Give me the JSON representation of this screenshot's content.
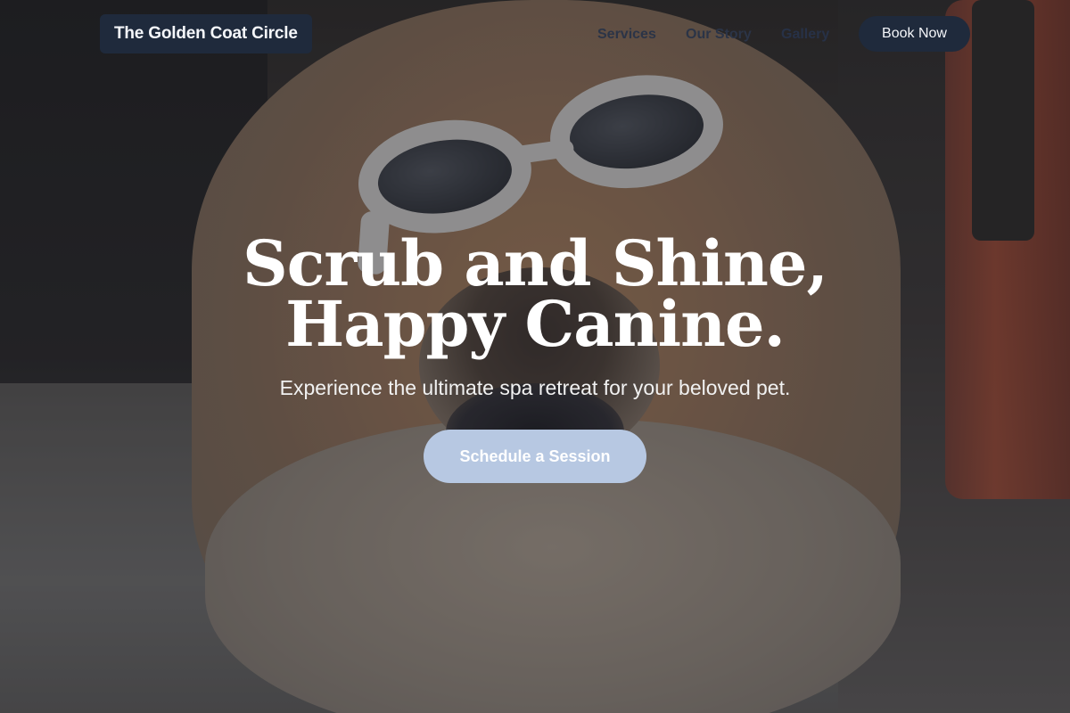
{
  "brand": {
    "name": "The Golden Coat Circle"
  },
  "nav": {
    "links": [
      "Services",
      "Our Story",
      "Gallery"
    ],
    "book_label": "Book Now"
  },
  "hero": {
    "headline_line1": "Scrub and Shine,",
    "headline_line2": "Happy Canine.",
    "subtitle": "Experience the ultimate spa retreat for your beloved pet.",
    "cta_label": "Schedule a Session",
    "background_image": "dog-with-sunglasses-photo"
  },
  "colors": {
    "nav_dark": "#1f2a3c",
    "cta": "#b7c8e2",
    "text_light": "#ffffff"
  }
}
